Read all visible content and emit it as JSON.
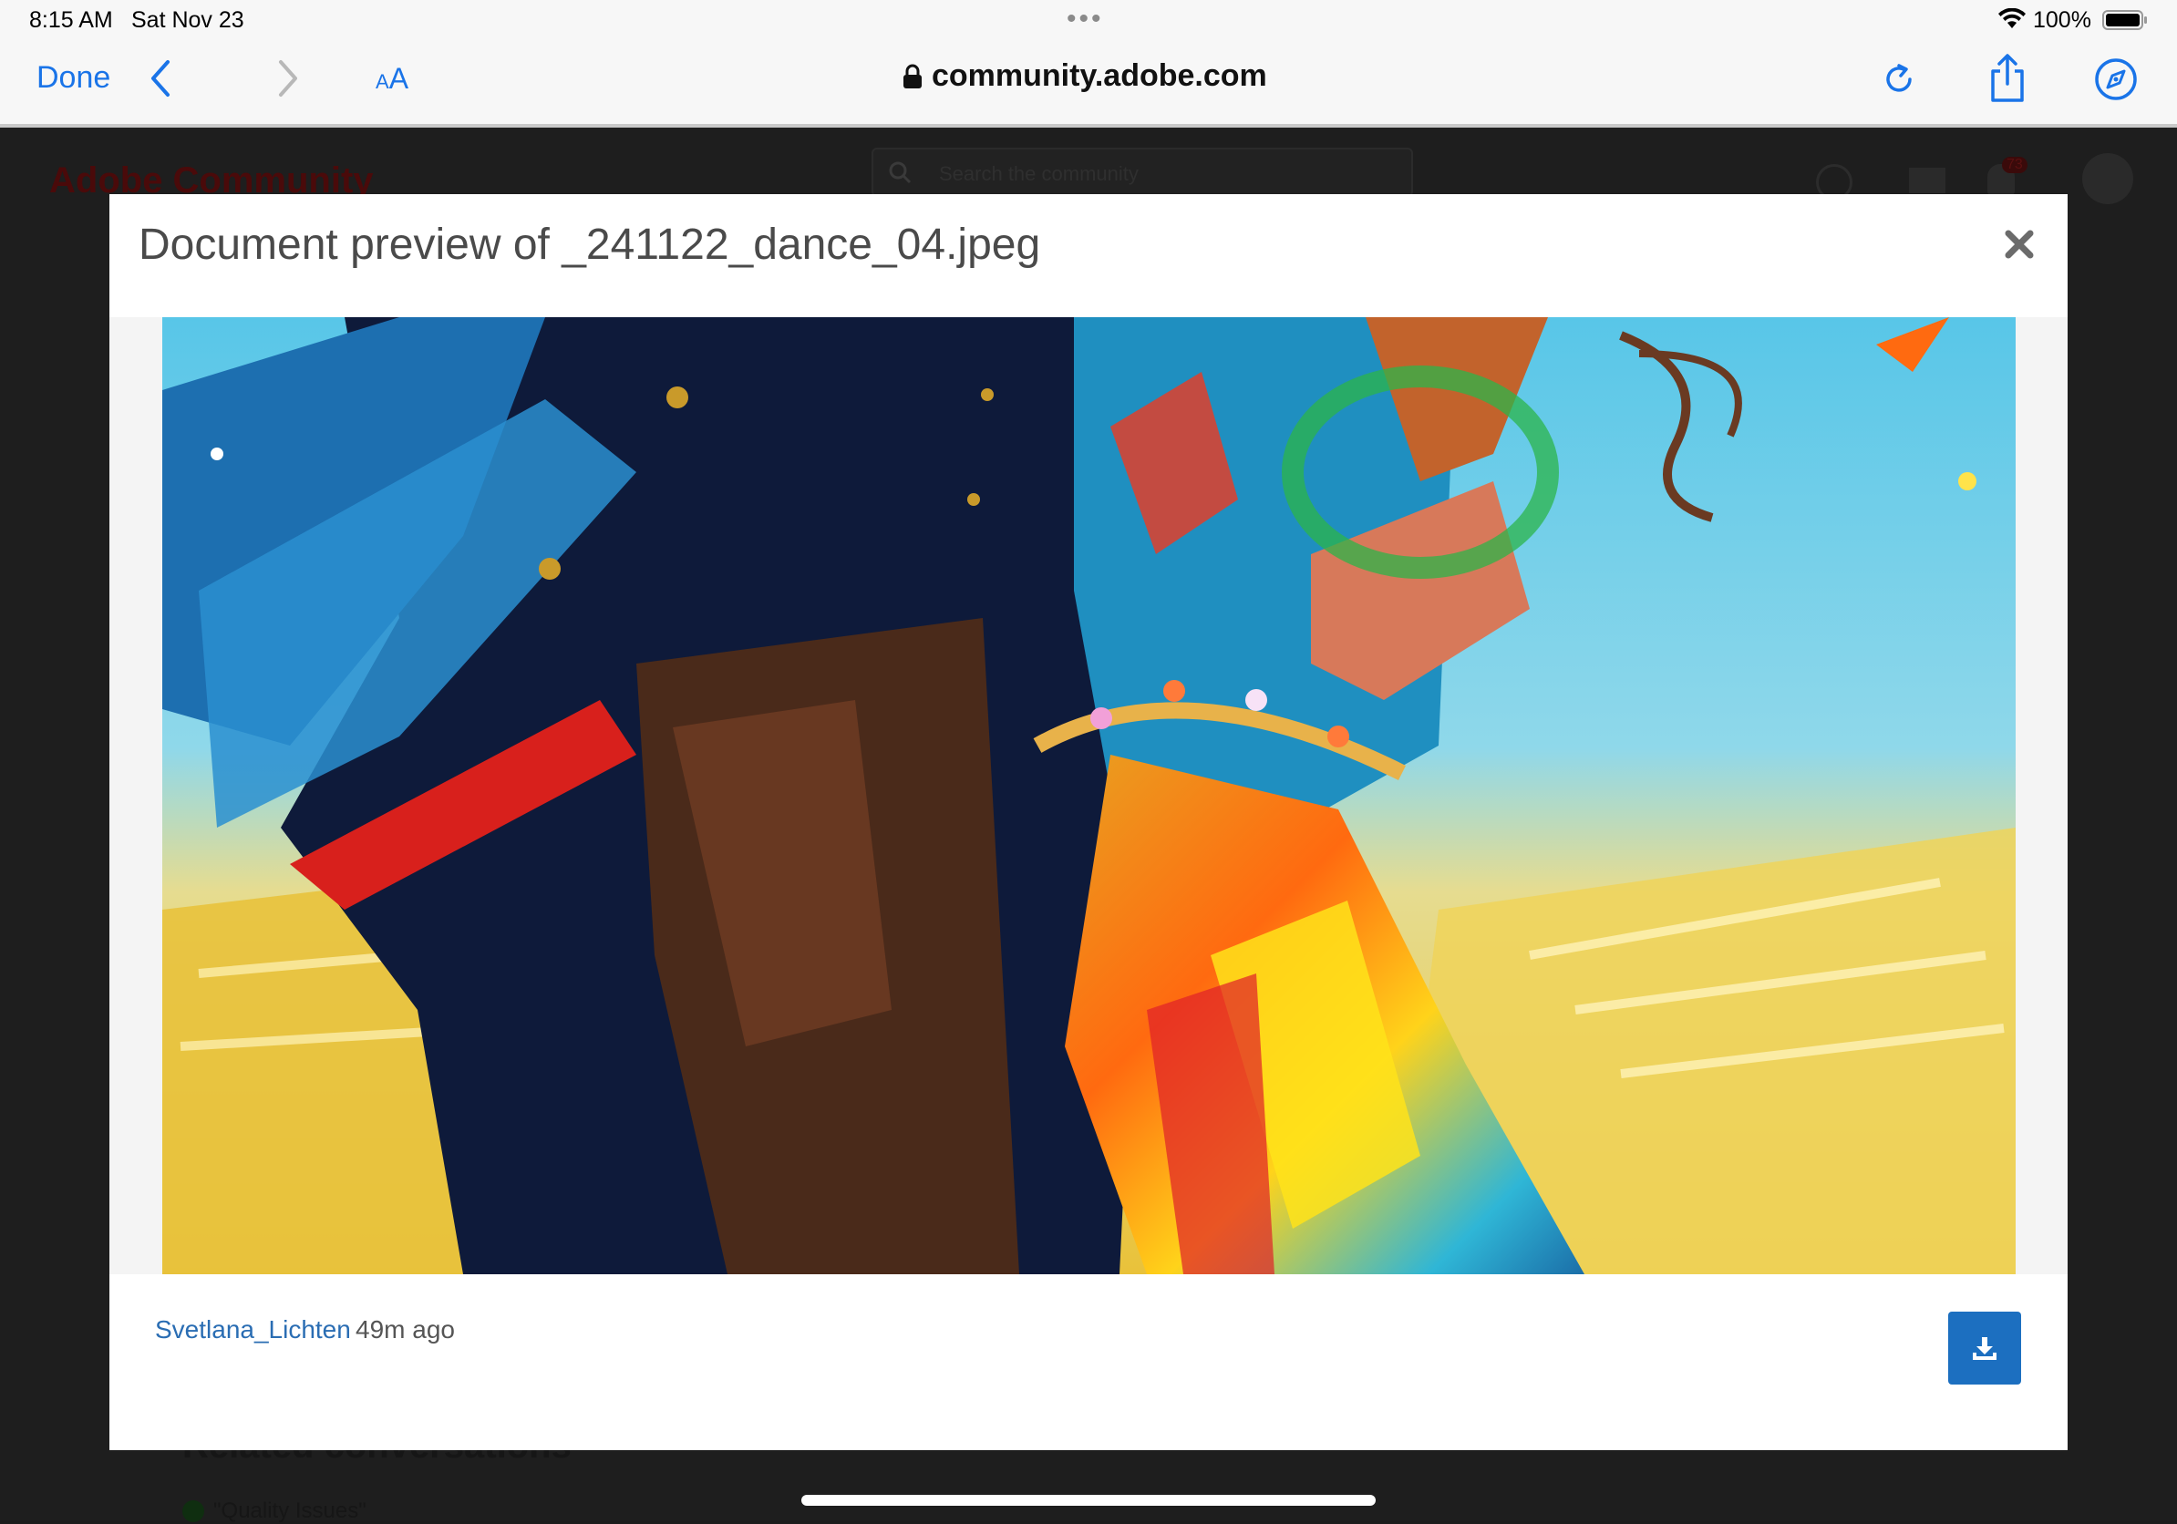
{
  "status_bar": {
    "time": "8:15 AM",
    "date": "Sat Nov 23",
    "battery_percent": "100%",
    "battery_level": 1.0
  },
  "browser": {
    "done_label": "Done",
    "text_size_label_small": "A",
    "text_size_label_large": "A",
    "url": "community.adobe.com",
    "accent_color": "#1a74e8"
  },
  "background_page": {
    "logo": "Adobe Community",
    "search_placeholder": "Search the community",
    "notification_count": "73",
    "related_heading": "Related conversations",
    "related_item": "\"Quality Issues\""
  },
  "modal": {
    "title": "Document preview of _241122_dance_04.jpeg",
    "author": "Svetlana_Lichten",
    "posted_ago": "49m ago",
    "image_subject": "painted-dancing-couple",
    "link_color": "#2a6db3",
    "download_button_color": "#1c6fc0"
  }
}
